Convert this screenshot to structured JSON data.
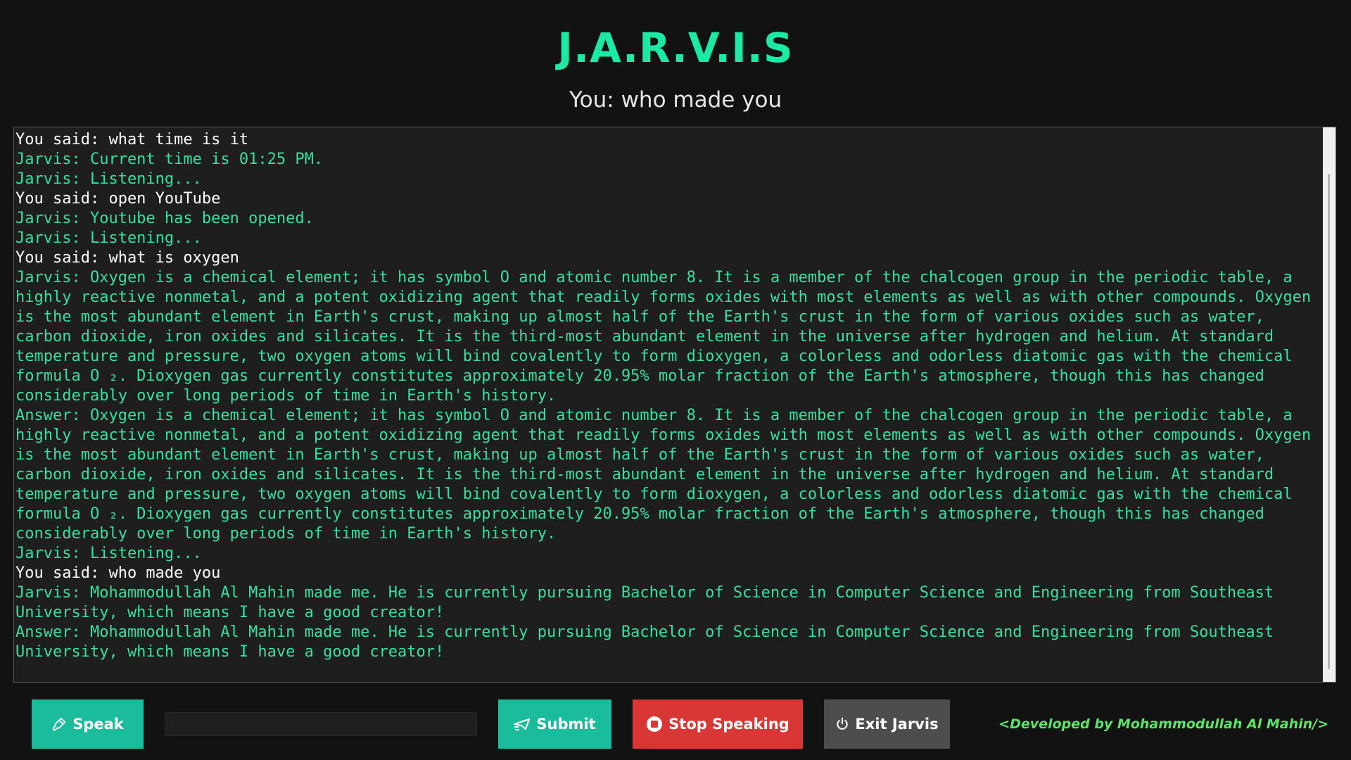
{
  "colors": {
    "accent": "#1de9a6",
    "jarvis_text": "#38e0a0",
    "user_text": "#ffffff",
    "subtitle_text": "#e6e6e6",
    "speak_bg": "#1abc9c",
    "submit_bg": "#1abc9c",
    "stop_bg": "#d93636",
    "exit_bg": "#4d4d4d",
    "credit_text": "#5ee26a"
  },
  "header": {
    "title": "J.A.R.V.I.S",
    "subtitle": "You: who made you"
  },
  "console": {
    "lines": [
      {
        "speaker": "user",
        "text": "You said: what time is it"
      },
      {
        "speaker": "jarvis",
        "text": "Jarvis: Current time is 01:25 PM."
      },
      {
        "speaker": "jarvis",
        "text": "Jarvis: Listening..."
      },
      {
        "speaker": "user",
        "text": "You said: open YouTube"
      },
      {
        "speaker": "jarvis",
        "text": "Jarvis: Youtube has been opened."
      },
      {
        "speaker": "jarvis",
        "text": "Jarvis: Listening..."
      },
      {
        "speaker": "user",
        "text": "You said: what is oxygen"
      },
      {
        "speaker": "jarvis",
        "text": "Jarvis: Oxygen is a chemical element; it has symbol O and atomic number 8. It is a member of the chalcogen group in the periodic table, a highly reactive nonmetal, and a potent oxidizing agent that readily forms oxides with most elements as well as with other compounds. Oxygen is the most abundant element in Earth's crust, making up almost half of the Earth's crust in the form of various oxides such as water, carbon dioxide, iron oxides and silicates. It is the third-most abundant element in the universe after hydrogen and helium. At standard temperature and pressure, two oxygen atoms will bind covalently to form dioxygen, a colorless and odorless diatomic gas with the chemical formula O ₂. Dioxygen gas currently constitutes approximately 20.95% molar fraction of the Earth's atmosphere, though this has changed considerably over long periods of time in Earth's history."
      },
      {
        "speaker": "jarvis",
        "text": "Answer: Oxygen is a chemical element; it has symbol O and atomic number 8. It is a member of the chalcogen group in the periodic table, a highly reactive nonmetal, and a potent oxidizing agent that readily forms oxides with most elements as well as with other compounds. Oxygen is the most abundant element in Earth's crust, making up almost half of the Earth's crust in the form of various oxides such as water, carbon dioxide, iron oxides and silicates. It is the third-most abundant element in the universe after hydrogen and helium. At standard temperature and pressure, two oxygen atoms will bind covalently to form dioxygen, a colorless and odorless diatomic gas with the chemical formula O ₂. Dioxygen gas currently constitutes approximately 20.95% molar fraction of the Earth's atmosphere, though this has changed considerably over long periods of time in Earth's history."
      },
      {
        "speaker": "jarvis",
        "text": "Jarvis: Listening..."
      },
      {
        "speaker": "user",
        "text": "You said: who made you"
      },
      {
        "speaker": "jarvis",
        "text": "Jarvis: Mohammodullah Al Mahin made me. He is currently pursuing Bachelor of Science in Computer Science and Engineering from Southeast University, which means I have a good creator!"
      },
      {
        "speaker": "jarvis",
        "text": "Answer: Mohammodullah Al Mahin made me. He is currently pursuing Bachelor of Science in Computer Science and Engineering from Southeast University, which means I have a good creator!"
      }
    ]
  },
  "controls": {
    "speak_label": "Speak",
    "speak_icon": "microphone-icon",
    "input_value": "",
    "input_placeholder": "",
    "submit_label": "Submit",
    "submit_icon": "send-icon",
    "stop_label": "Stop Speaking",
    "stop_icon": "stop-icon",
    "exit_label": "Exit Jarvis",
    "exit_icon": "power-icon"
  },
  "footer": {
    "credit": "<Developed by Mohammodullah Al Mahin/>"
  }
}
